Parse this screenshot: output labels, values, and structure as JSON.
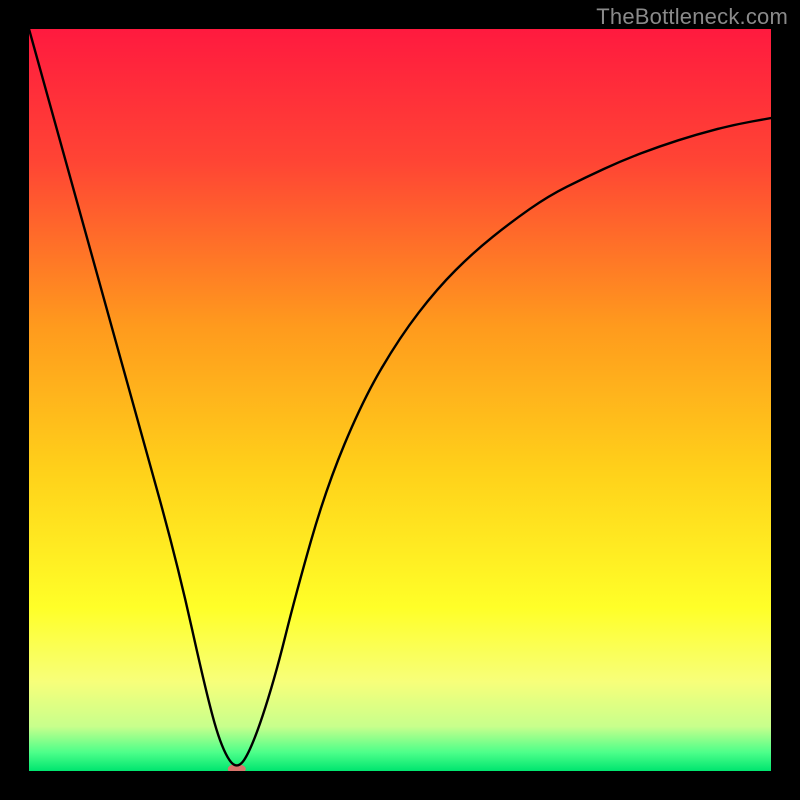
{
  "watermark": "TheBottleneck.com",
  "chart_data": {
    "type": "line",
    "title": "",
    "xlabel": "",
    "ylabel": "",
    "xlim": [
      0,
      100
    ],
    "ylim": [
      0,
      100
    ],
    "grid": false,
    "legend": false,
    "background_gradient": {
      "stops": [
        {
          "offset": 0.0,
          "color": "#ff1a3f"
        },
        {
          "offset": 0.18,
          "color": "#ff4534"
        },
        {
          "offset": 0.4,
          "color": "#ff9a1d"
        },
        {
          "offset": 0.6,
          "color": "#ffd21a"
        },
        {
          "offset": 0.78,
          "color": "#ffff28"
        },
        {
          "offset": 0.88,
          "color": "#f7ff7a"
        },
        {
          "offset": 0.94,
          "color": "#c8ff8c"
        },
        {
          "offset": 0.975,
          "color": "#4dff8a"
        },
        {
          "offset": 1.0,
          "color": "#00e56f"
        }
      ]
    },
    "series": [
      {
        "name": "bottleneck-curve",
        "x": [
          0,
          5,
          10,
          15,
          20,
          24,
          26,
          28,
          30,
          33,
          36,
          40,
          45,
          50,
          55,
          60,
          65,
          70,
          75,
          80,
          85,
          90,
          95,
          100
        ],
        "y": [
          100,
          82,
          64,
          46,
          28,
          10,
          3,
          0,
          3,
          12,
          24,
          38,
          50,
          58.5,
          65,
          70,
          74,
          77.5,
          80,
          82.3,
          84.2,
          85.8,
          87.1,
          88
        ]
      }
    ],
    "marker": {
      "name": "min-marker",
      "x": 28,
      "y": 0,
      "color": "#d9746c",
      "rx": 9,
      "ry": 5
    }
  }
}
